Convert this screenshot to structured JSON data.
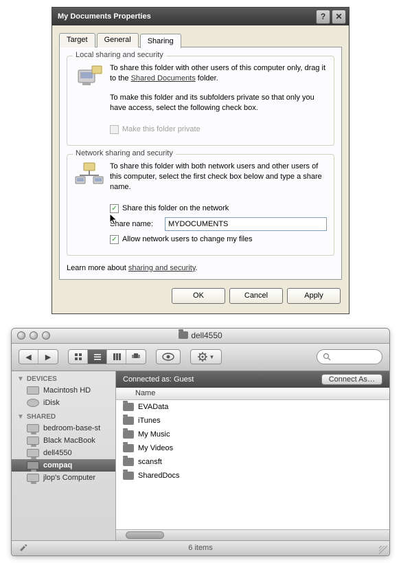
{
  "win": {
    "title": "My Documents Properties",
    "tabs": {
      "target": "Target",
      "general": "General",
      "sharing": "Sharing"
    },
    "local": {
      "legend": "Local sharing and security",
      "p1a": "To share this folder with other users of this computer only, drag it to the ",
      "p1link": "Shared Documents",
      "p1b": " folder.",
      "p2": "To make this folder and its subfolders private so that only you have access, select the following check box.",
      "chk_label": "Make this folder private"
    },
    "net": {
      "legend": "Network sharing and security",
      "p1": "To share this folder with both network users and other users of this computer, select the first check box below and type a share name.",
      "chk_share_label": "Share this folder on the network",
      "share_name_label": "Share name:",
      "share_name_value": "MYDOCUMENTS",
      "chk_allow_label": "Allow network users to change my files"
    },
    "learn_a": "Learn more about ",
    "learn_link": "sharing and security",
    "learn_b": ".",
    "buttons": {
      "ok": "OK",
      "cancel": "Cancel",
      "apply": "Apply"
    }
  },
  "mac": {
    "title": "dell4550",
    "conn_text": "Connected as: Guest",
    "conn_btn": "Connect As…",
    "col_name": "Name",
    "sb_devices": "DEVICES",
    "sb_shared": "SHARED",
    "devices": {
      "hd": "Macintosh HD",
      "idisk": "iDisk"
    },
    "shared": {
      "a": "bedroom-base-st",
      "b": "Black MacBook",
      "c": "dell4550",
      "d": "compaq",
      "e": "jlop's Computer"
    },
    "files": {
      "a": "EVAData",
      "b": "iTunes",
      "c": "My Music",
      "d": "My Videos",
      "e": "scansft",
      "f": "SharedDocs"
    },
    "status": "6 items"
  }
}
